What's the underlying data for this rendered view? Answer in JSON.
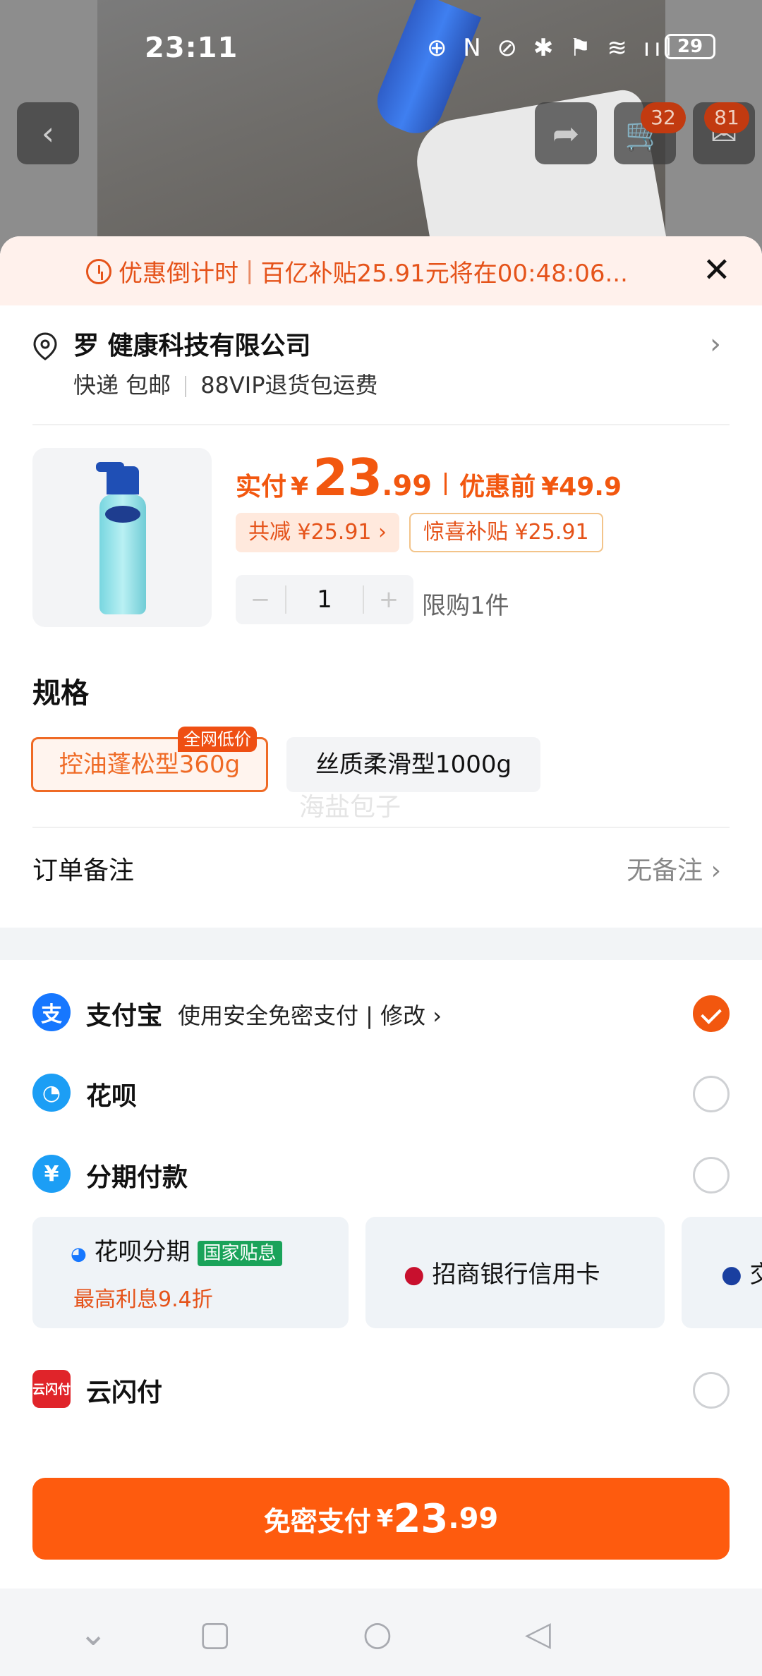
{
  "status_bar": {
    "time": "23:11",
    "icons": "⊕ N ⊘ ✱ ⚑ ≋ ııl",
    "battery": "29"
  },
  "background_page": {
    "cart_badge": "32",
    "msg_badge": "81"
  },
  "countdown": {
    "label": "优惠倒计时",
    "text": "百亿补贴25.91元将在00:48:06..."
  },
  "address": {
    "name": "罗 健康科技有限公司",
    "shipping": "快递 包邮",
    "return_policy": "88VIP退货包运费"
  },
  "product": {
    "price_label": "实付",
    "currency": "¥",
    "price_int": "23",
    "price_dec": ".99",
    "orig_label": "优惠前",
    "orig_price": "¥49.9",
    "discount_tag": "共减 ¥25.91 ›",
    "subsidy_tag": "惊喜补贴 ¥25.91",
    "qty": "1",
    "limit": "限购1件"
  },
  "spec": {
    "title": "规格",
    "options": [
      {
        "label": "控油蓬松型360g",
        "badge": "全网低价",
        "selected": true
      },
      {
        "label": "丝质柔滑型1000g",
        "selected": false
      }
    ],
    "watermark": "海盐包子"
  },
  "remark": {
    "label": "订单备注",
    "value": "无备注"
  },
  "payment": {
    "alipay": {
      "title": "支付宝",
      "desc": "使用安全免密支付 | 修改 ›",
      "selected": true
    },
    "huabei": {
      "title": "花呗",
      "selected": false
    },
    "installment": {
      "title": "分期付款",
      "selected": false
    },
    "cards": [
      {
        "title": "花呗分期",
        "gov_badge": "国家贴息",
        "sub": "最高利息9.4折"
      },
      {
        "title": "招商银行信用卡"
      },
      {
        "title": "交"
      }
    ],
    "unionpay": {
      "title": "云闪付",
      "selected": false
    }
  },
  "pay_button": {
    "label": "免密支付",
    "currency": "¥",
    "amount_int": "23",
    "amount_dec": ".99"
  },
  "colors": {
    "accent": "#fe5b0e",
    "price": "#f2570f",
    "alipay": "#1677ff"
  }
}
